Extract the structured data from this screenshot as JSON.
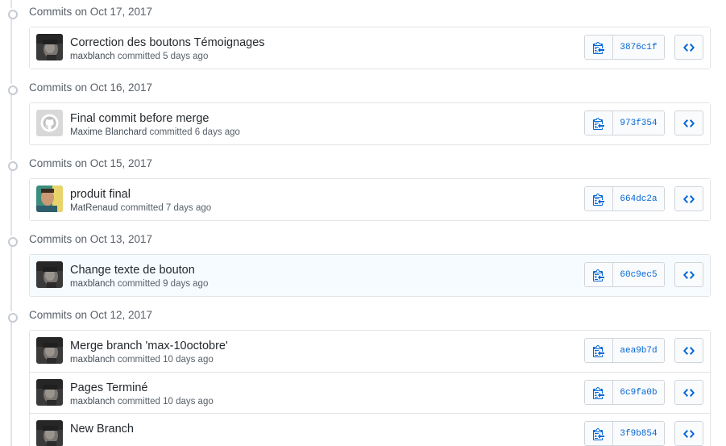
{
  "groups": [
    {
      "date_label": "Commits on Oct 17, 2017",
      "commits": [
        {
          "title": "Correction des boutons Témoignages",
          "author": "maxblanch",
          "verb": "committed",
          "time": "5 days ago",
          "sha": "3876c1f",
          "avatar": "photo-dark",
          "highlight": false
        }
      ]
    },
    {
      "date_label": "Commits on Oct 16, 2017",
      "commits": [
        {
          "title": "Final commit before merge",
          "author": "Maxime Blanchard",
          "verb": "committed",
          "time": "6 days ago",
          "sha": "973f354",
          "avatar": "github-octocat",
          "highlight": false
        }
      ]
    },
    {
      "date_label": "Commits on Oct 15, 2017",
      "commits": [
        {
          "title": "produit final",
          "author": "MatRenaud",
          "verb": "committed",
          "time": "7 days ago",
          "sha": "664dc2a",
          "avatar": "photo-teal",
          "highlight": false
        }
      ]
    },
    {
      "date_label": "Commits on Oct 13, 2017",
      "commits": [
        {
          "title": "Change texte de bouton",
          "author": "maxblanch",
          "verb": "committed",
          "time": "9 days ago",
          "sha": "60c9ec5",
          "avatar": "photo-dark",
          "highlight": true
        }
      ]
    },
    {
      "date_label": "Commits on Oct 12, 2017",
      "commits": [
        {
          "title": "Merge branch 'max-10octobre'",
          "author": "maxblanch",
          "verb": "committed",
          "time": "10 days ago",
          "sha": "aea9b7d",
          "avatar": "photo-dark",
          "highlight": false
        },
        {
          "title": "Pages Terminé",
          "author": "maxblanch",
          "verb": "committed",
          "time": "10 days ago",
          "sha": "6c9fa0b",
          "avatar": "photo-dark",
          "highlight": false
        },
        {
          "title": "New Branch",
          "author": "",
          "verb": "",
          "time": "",
          "sha": "3f9b854",
          "avatar": "photo-dark",
          "highlight": false
        }
      ]
    }
  ],
  "icons": {
    "copy": "clipboard-copy-icon",
    "browse": "code-brackets-icon",
    "dot": "git-commit-icon"
  },
  "colors": {
    "link": "#0366d6",
    "border": "#e1e4e8",
    "muted": "#586069",
    "highlight_bg": "#f6fbff"
  }
}
